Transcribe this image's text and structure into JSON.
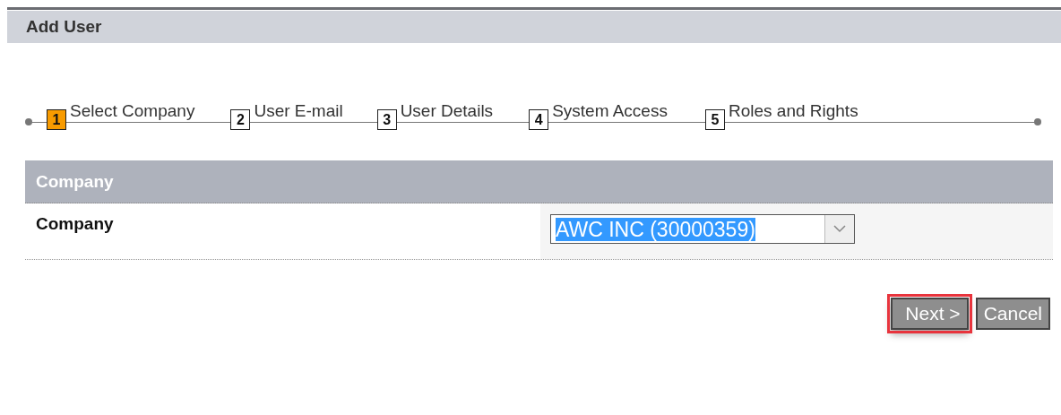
{
  "header": {
    "title": "Add User"
  },
  "steps": [
    {
      "number": "1",
      "label": "Select Company",
      "selected": true
    },
    {
      "number": "2",
      "label": "User E-mail",
      "selected": false
    },
    {
      "number": "3",
      "label": "User Details",
      "selected": false
    },
    {
      "number": "4",
      "label": "System Access",
      "selected": false
    },
    {
      "number": "5",
      "label": "Roles and Rights",
      "selected": false
    }
  ],
  "section": {
    "title": "Company",
    "fields": [
      {
        "label": "Company",
        "value": "AWC INC (30000359)",
        "value_selected": true
      }
    ]
  },
  "buttons": [
    {
      "label": "Next >",
      "highlighted": true
    },
    {
      "label": "Cancel",
      "highlighted": false
    }
  ]
}
